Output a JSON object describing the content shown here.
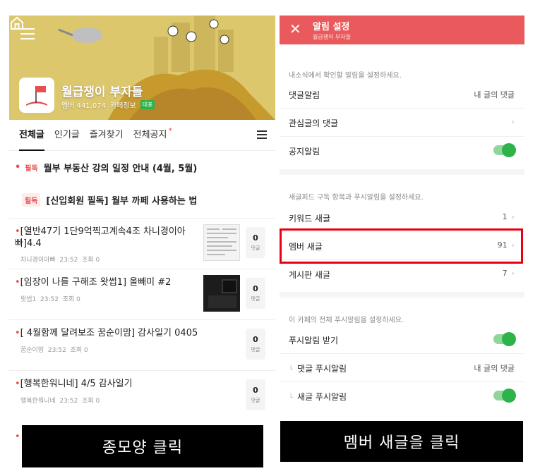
{
  "left": {
    "cafe_name": "월급쟁이 부자들",
    "members": "멤버 441,074",
    "cafe_info": "카페정보",
    "badge": "대표",
    "tabs": [
      {
        "label": "전체글",
        "active": true
      },
      {
        "label": "인기글"
      },
      {
        "label": "즐겨찾기"
      },
      {
        "label": "전체공지",
        "new_dot": "*"
      }
    ],
    "notices": [
      {
        "tag": "필독",
        "title": "월부 부동산 강의 일정 안내 (4월, 5월)"
      },
      {
        "tag": "필독",
        "title": "[신입회원 필독] 월부 까페 사용하는 법"
      }
    ],
    "posts": [
      {
        "title": "[열반47기 1단9억찍고계속4조 차니경이아빠]4.4",
        "author": "차니경이아빠",
        "time": "23:52",
        "views": "조회 0",
        "comments": "0"
      },
      {
        "title": "[임장이 나를 구해조 왓썹1] 올빼미 #2",
        "author": "왓썹1",
        "time": "23:52",
        "views": "조회 0",
        "comments": "0"
      },
      {
        "title": "[ 4월함께 달려보조 꿈순이맘] 감사일기 0405",
        "author": "꿈순이맘",
        "time": "23:52",
        "views": "조회 0",
        "comments": "0"
      },
      {
        "title": "[행복한워니네] 4/5 감사일기",
        "author": "행복한워니네",
        "time": "23:52",
        "views": "조회 0",
        "comments": "0"
      }
    ],
    "comment_label": "댓글",
    "caption": "종모양 클릭"
  },
  "right": {
    "title": "알림 설정",
    "subtitle": "월급쟁이 부자들",
    "hint1": "내소식에서 확인할 알림을 설정하세요.",
    "comment_alert": {
      "label": "댓글알림",
      "value": "내 글의 댓글"
    },
    "interest_comments": {
      "label": "관심글의 댓글"
    },
    "notice_alert": {
      "label": "공지알림",
      "on": true
    },
    "hint2": "새글피드 구독 항목과 푸시알림을 설정하세요.",
    "keyword": {
      "label": "키워드 새글",
      "value": "1"
    },
    "member": {
      "label": "멤버 새글",
      "value": "91"
    },
    "board": {
      "label": "게시판 새글",
      "value": "7"
    },
    "hint3": "이 카페의 전체 푸시알림을 설정하세요.",
    "push": {
      "label": "푸시알림 받기",
      "on": true
    },
    "comment_push": {
      "label": "댓글 푸시알림",
      "value": "내 글의 댓글"
    },
    "newpost_push": {
      "label": "새글 푸시알림",
      "on": true
    },
    "caption": "멤버 새글을 클릭"
  },
  "colors": {
    "accent_red": "#ea5a5c",
    "toggle_green": "#2db34a",
    "highlight_red": "#e60012"
  }
}
